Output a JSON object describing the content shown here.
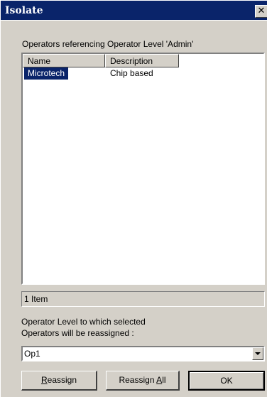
{
  "window": {
    "title": "Isolate",
    "close_glyph": "✕"
  },
  "caption": "Operators referencing Operator Level 'Admin'",
  "list": {
    "columns": [
      "Name",
      "Description"
    ],
    "rows": [
      {
        "name": "Microtech",
        "description": "Chip based",
        "selected": true
      }
    ]
  },
  "status": "1 Item",
  "reassign": {
    "label_line1": "Operator Level to which selected",
    "label_line2": "Operators will be reassigned :",
    "selected_value": "Op1"
  },
  "buttons": {
    "reassign": {
      "mnemonic": "R",
      "rest": "eassign"
    },
    "reassign_all": {
      "prefix": "Reassign ",
      "mnemonic": "A",
      "rest": "ll"
    },
    "ok": "OK"
  },
  "colors": {
    "titlebar": "#0a246a",
    "selection": "#0a246a",
    "face": "#d4d0c8"
  },
  "icons": {
    "close": "close-icon",
    "dropdown": "chevron-down-icon"
  }
}
